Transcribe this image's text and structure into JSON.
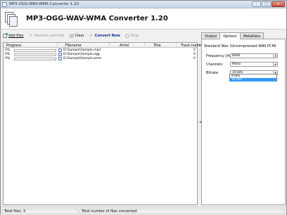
{
  "window": {
    "title": "MP3-OGG-WAV-WMA Converter 1.20",
    "controls": [
      "–",
      "□",
      "✕"
    ]
  },
  "header": {
    "app_title": "MP3-OGG-WAV-WMA Converter 1.20"
  },
  "toolbar": {
    "add_files": "Add files",
    "remove_selected": "Remove selected",
    "clear": "Clear",
    "convert_now": "Convert Now",
    "stop": "Stop"
  },
  "file_list": {
    "columns": [
      "Progress",
      "Filename",
      "Artist",
      "Title",
      "Track number"
    ],
    "rows": [
      {
        "progress_label": "0%",
        "progress": 0,
        "filename": "D:\\Sample\\Sample.mp3",
        "track": "0"
      },
      {
        "progress_label": "0%",
        "progress": 0,
        "filename": "D:\\Sample\\Sample.ogg",
        "track": "0"
      },
      {
        "progress_label": "0%",
        "progress": 0,
        "filename": "D:\\Sample\\Sample.wma",
        "track": "0"
      }
    ]
  },
  "options": {
    "tabs": [
      "Output",
      "Options",
      "MetaData"
    ],
    "active_tab": "Options",
    "heading": "Standard Wav (Uncompressed WAV PCM)",
    "frequency": {
      "label": "Frequency [Hz]",
      "value": "8000"
    },
    "channels": {
      "label": "Channels",
      "value": "Mono"
    },
    "bitrate": {
      "label": "Bitrate",
      "value": "16 bits",
      "options": [
        "8 bits",
        "16 bits"
      ],
      "highlighted": "16 bits"
    }
  },
  "status": {
    "total_files": "Total files: 3",
    "converted": "Total number of files converted:"
  },
  "colors": {
    "accent": "#3399ff",
    "progress_fill": "#2e9b3d",
    "convert_label": "#0b2fa8"
  }
}
